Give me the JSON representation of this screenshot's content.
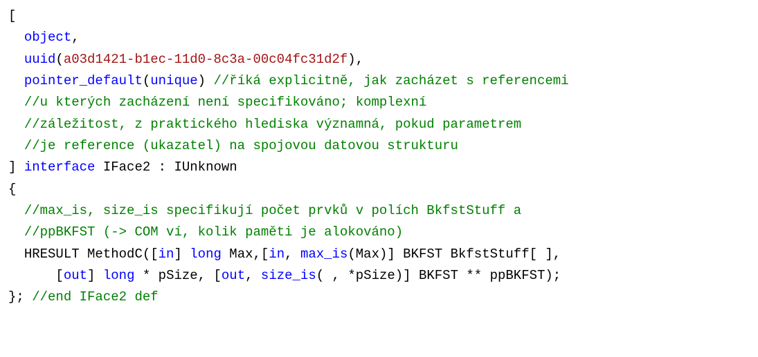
{
  "code": {
    "line1_open": "[",
    "line2_kw": "object",
    "line2_punc": ",",
    "line3_kw": "uuid",
    "line3_open": "(",
    "line3_uuid": "a03d1421-b1ec-11d0-8c3a-00c04fc31d2f",
    "line3_close": "),",
    "line4_kw": "pointer_default",
    "line4_open": "(",
    "line4_arg": "unique",
    "line4_close": ") ",
    "line4_com": "//říká explicitně, jak zacházet s referencemi",
    "line5_com": "//u kterých zacházení není specifikováno; komplexní",
    "line6_com": "//záležitost, z praktického hlediska významná, pokud parametrem",
    "line7_com": "//je reference (ukazatel) na spojovou datovou strukturu",
    "line8_close": "] ",
    "line8_kw_interface": "interface",
    "line8_rest": " IFace2 : IUnknown",
    "line9_open": "{",
    "line10_com": "//max_is, size_is specifikují počet prvků v polích BkfstStuff a",
    "line11_com": "//ppBKFST (-> COM ví, kolik paměti je alokováno)",
    "line12_a": "HRESULT MethodC([",
    "line12_kw_in1": "in",
    "line12_b": "] ",
    "line12_kw_long1": "long",
    "line12_c": " Max,[",
    "line12_kw_in2": "in",
    "line12_d": ", ",
    "line12_kw_maxis": "max_is",
    "line12_e": "(Max)] BKFST BkfstStuff[ ],",
    "line13_a": "[",
    "line13_kw_out1": "out",
    "line13_b": "] ",
    "line13_kw_long2": "long",
    "line13_c": " * pSize, [",
    "line13_kw_out2": "out",
    "line13_d": ", ",
    "line13_kw_sizeis": "size_is",
    "line13_e": "( , *pSize)] BKFST ** ppBKFST);",
    "line14_a": "}; ",
    "line14_com": "//end IFace2 def"
  }
}
